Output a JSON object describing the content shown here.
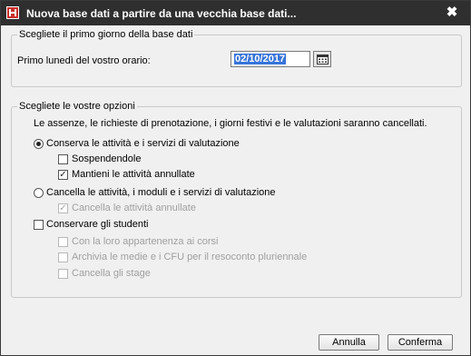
{
  "window": {
    "title": "Nuova base dati a partire da una vecchia base dati...",
    "close_glyph": "✖"
  },
  "group1": {
    "legend": "Scegliete il primo giorno della base dati",
    "field_label": "Primo lunedì del vostro orario:",
    "date_value": "02/10/2017"
  },
  "group2": {
    "legend": "Scegliete le vostre opzioni",
    "warning": "Le assenze, le richieste di prenotazione, i giorni festivi e le valutazioni saranno cancellati.",
    "options": {
      "conserva": {
        "label": "Conserva le attività e i servizi di valutazione",
        "checked": true
      },
      "sospendendole": {
        "label": "Sospendendole",
        "checked": false
      },
      "mantieni": {
        "label": "Mantieni le attività annullate",
        "checked": true
      },
      "cancella": {
        "label": "Cancella le attività, i moduli e i servizi di valutazione",
        "checked": false
      },
      "cancella_annullate": {
        "label": "Cancella le attività annullate",
        "checked": true,
        "disabled": true
      },
      "conservare_studenti": {
        "label": "Conservare gli studenti",
        "checked": false
      },
      "appartenenza": {
        "label": "Con la loro appartenenza ai corsi",
        "checked": false,
        "disabled": true
      },
      "archivia": {
        "label": "Archivia le medie e i CFU per il resoconto pluriennale",
        "checked": false,
        "disabled": true
      },
      "stage": {
        "label": "Cancella gli stage",
        "checked": false,
        "disabled": true
      }
    }
  },
  "buttons": {
    "cancel": "Annulla",
    "confirm": "Conferma"
  },
  "icons": {
    "app": "app-logo-icon",
    "calendar": "calendar-icon"
  }
}
